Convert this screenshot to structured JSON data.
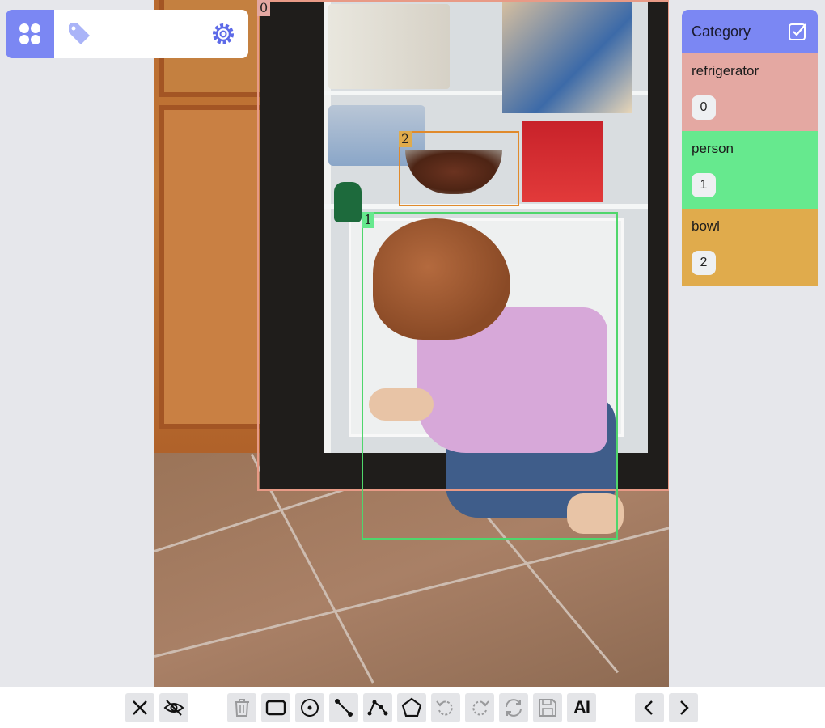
{
  "categories_panel": {
    "title": "Category",
    "items": [
      {
        "name": "refrigerator",
        "id": "0",
        "color": "#e4a8a2"
      },
      {
        "name": "person",
        "id": "1",
        "color": "#66e98e"
      },
      {
        "name": "bowl",
        "id": "2",
        "color": "#e0ab4c"
      }
    ]
  },
  "annotations": [
    {
      "label": "0",
      "category": "refrigerator",
      "color": "#e89a86"
    },
    {
      "label": "1",
      "category": "person",
      "color": "#4fd66c"
    },
    {
      "label": "2",
      "category": "bowl",
      "color": "#e08a2c"
    }
  ],
  "top_toolbar": {
    "icons": [
      "apps-icon",
      "tag-icon",
      "settings-gear-icon"
    ],
    "accent": "#7b87f3"
  },
  "bottom_toolbar": {
    "ai_label": "AI",
    "tools": [
      "close-icon",
      "hide-eye-icon",
      "delete-icon",
      "rectangle-icon",
      "point-icon",
      "line-icon",
      "polyline-icon",
      "polygon-icon",
      "undo-icon",
      "redo-icon",
      "reset-icon",
      "save-icon",
      "ai-icon",
      "previous-icon",
      "next-icon"
    ]
  }
}
